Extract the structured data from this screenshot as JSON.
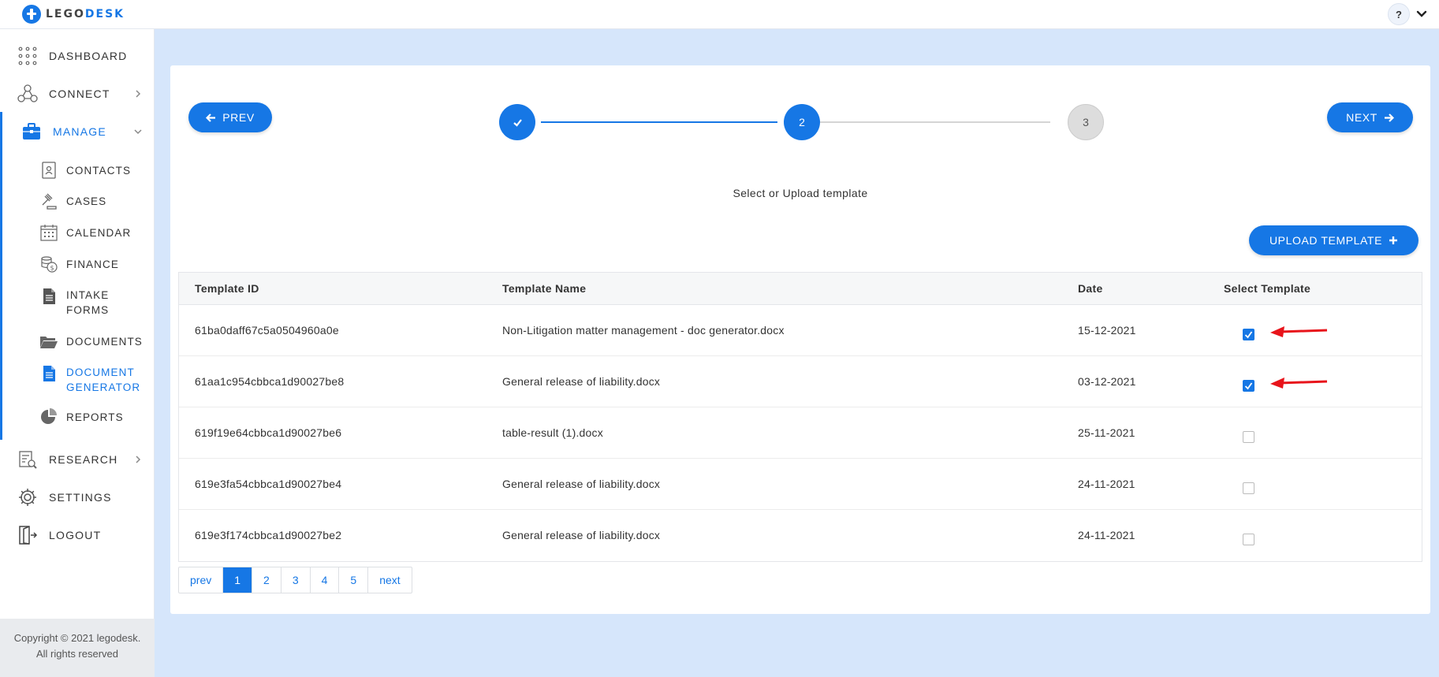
{
  "brand": {
    "lego": "LEGO",
    "desk": "DESK"
  },
  "header": {
    "help_label": "?"
  },
  "sidebar": {
    "items": [
      {
        "label": "DASHBOARD"
      },
      {
        "label": "CONNECT"
      },
      {
        "label": "MANAGE"
      },
      {
        "label": "RESEARCH"
      },
      {
        "label": "SETTINGS"
      },
      {
        "label": "LOGOUT"
      }
    ],
    "manage_sub": [
      {
        "label": "CONTACTS"
      },
      {
        "label": "CASES"
      },
      {
        "label": "CALENDAR"
      },
      {
        "label": "FINANCE"
      },
      {
        "label": "INTAKE FORMS"
      },
      {
        "label": "DOCUMENTS"
      },
      {
        "label": "DOCUMENT GENERATOR"
      },
      {
        "label": "REPORTS"
      }
    ],
    "copyright_line1": "Copyright © 2021 legodesk.",
    "copyright_line2": "All rights reserved"
  },
  "wizard": {
    "prev_label": "PREV",
    "next_label": "NEXT",
    "steps": [
      "",
      "2",
      "3"
    ],
    "subtitle": "Select or Upload template",
    "upload_label": "UPLOAD TEMPLATE"
  },
  "table": {
    "headers": [
      "Template ID",
      "Template Name",
      "Date",
      "Select Template"
    ],
    "rows": [
      {
        "id": "61ba0daff67c5a0504960a0e",
        "name": "Non-Litigation matter management - doc generator.docx",
        "date": "15-12-2021",
        "selected": true
      },
      {
        "id": "61aa1c954cbbca1d90027be8",
        "name": "General release of liability.docx",
        "date": "03-12-2021",
        "selected": true
      },
      {
        "id": "619f19e64cbbca1d90027be6",
        "name": "table-result (1).docx",
        "date": "25-11-2021",
        "selected": false
      },
      {
        "id": "619e3fa54cbbca1d90027be4",
        "name": "General release of liability.docx",
        "date": "24-11-2021",
        "selected": false
      },
      {
        "id": "619e3f174cbbca1d90027be2",
        "name": "General release of liability.docx",
        "date": "24-11-2021",
        "selected": false
      }
    ]
  },
  "pagination": {
    "prev": "prev",
    "pages": [
      "1",
      "2",
      "3",
      "4",
      "5"
    ],
    "next": "next",
    "current": "1"
  },
  "colors": {
    "accent": "#1677e5",
    "annotation": "#e8141b",
    "page_bg": "#d6e6fb"
  }
}
